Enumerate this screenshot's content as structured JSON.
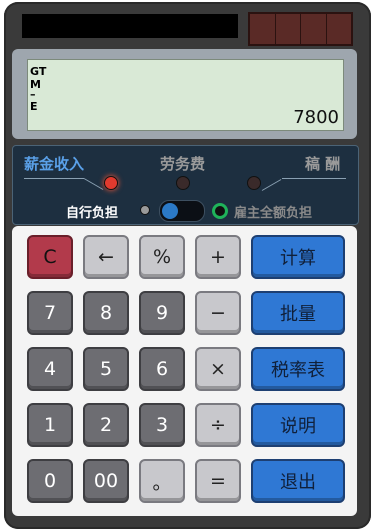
{
  "display": {
    "indicators": [
      "GT",
      "M",
      "–",
      "E"
    ],
    "value": "7800"
  },
  "modes": {
    "salary": "薪金收入",
    "labor": "劳务费",
    "manuscript": "稿 酬",
    "self_pay": "自行负担",
    "employer_pay": "雇主全额负担"
  },
  "colors": {
    "salary_label": "#5aa0e8",
    "labor_label": "#9a9a9a",
    "manuscript_label": "#9a9a9a",
    "lamp_red": "#e13a2e",
    "lamp_green": "#1fb35a",
    "lamp_off": "#3a2a2a",
    "accent_blue": "#2f78d4"
  },
  "keys": {
    "clear": "C",
    "back": "←",
    "percent": "%",
    "plus": "+",
    "seven": "7",
    "eight": "8",
    "nine": "9",
    "minus": "−",
    "four": "4",
    "five": "5",
    "six": "6",
    "times": "×",
    "one": "1",
    "two": "2",
    "three": "3",
    "divide": "÷",
    "zero": "0",
    "double_zero": "00",
    "dot": "。",
    "equals": "=",
    "calculate": "计算",
    "batch": "批量",
    "tax_table": "税率表",
    "help": "说明",
    "exit": "退出"
  }
}
